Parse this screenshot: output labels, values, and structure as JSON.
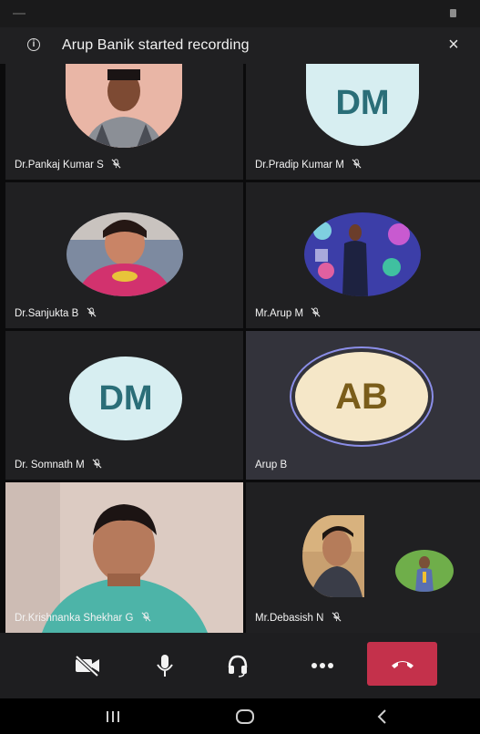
{
  "banner": {
    "message": "Arup Banik started recording",
    "info_icon": "i",
    "close_icon": "×"
  },
  "participants": [
    {
      "name": "Dr.Pankaj Kumar S",
      "avatar": "photo",
      "muted": true
    },
    {
      "name": "Dr.Pradip Kumar M",
      "avatar": "initials",
      "initials": "DM",
      "muted": true
    },
    {
      "name": "Dr.Sanjukta B",
      "avatar": "photo",
      "muted": true
    },
    {
      "name": "Mr.Arup M",
      "avatar": "photo",
      "muted": true
    },
    {
      "name": "Dr. Somnath M",
      "avatar": "initials",
      "initials": "DM",
      "muted": true
    },
    {
      "name": "Arup B",
      "avatar": "initials",
      "initials": "AB",
      "muted": false,
      "speaking": true
    },
    {
      "name": "Dr.Krishnanka Shekhar G",
      "avatar": "video",
      "muted": true
    },
    {
      "name": "Mr.Debasish N",
      "avatar": "photo",
      "muted": true
    }
  ],
  "toolbar": {
    "buttons": [
      "camera-off-icon",
      "microphone-icon",
      "headset-icon",
      "more-icon",
      "end-call-icon"
    ]
  },
  "navbar": {
    "buttons": [
      "recent-apps-icon",
      "home-icon",
      "back-icon"
    ]
  },
  "colors": {
    "tile_bg": "#202022",
    "active_tile_bg": "#33333b",
    "dm_avatar_bg": "#d7eef1",
    "dm_avatar_text": "#2a6e78",
    "ab_avatar_bg": "#f5e7c8",
    "ab_avatar_text": "#7a5d1a",
    "speaking_ring": "#8b8ee8",
    "end_call": "#c4314b"
  }
}
